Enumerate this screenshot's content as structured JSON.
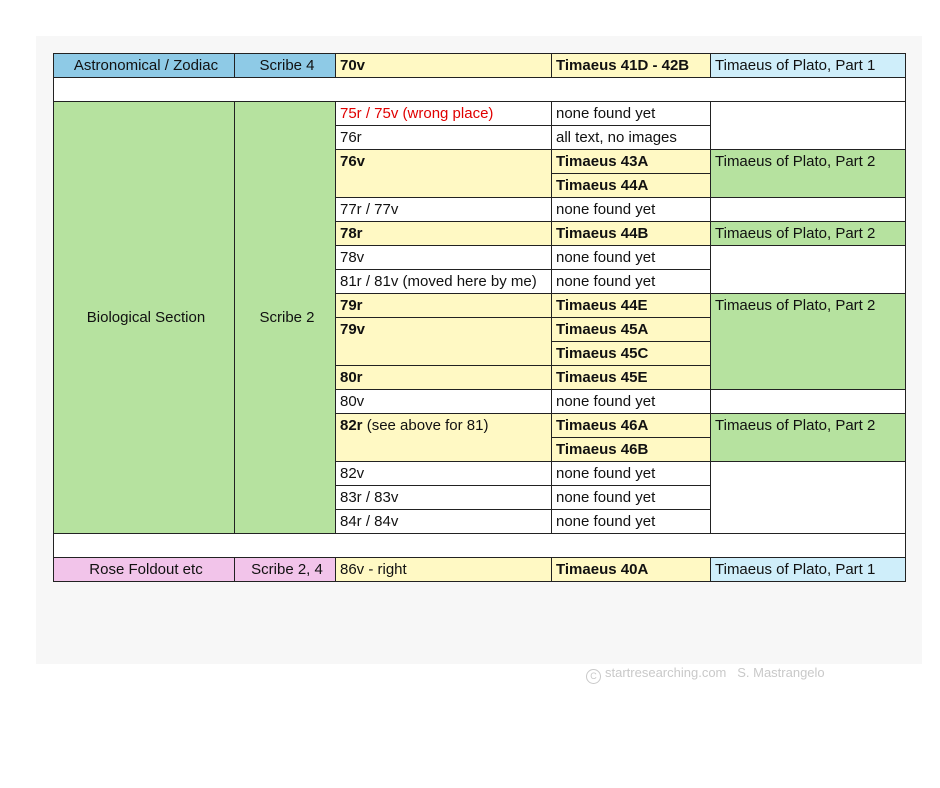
{
  "rows": {
    "astro": {
      "section": "Astronomical / Zodiac",
      "scribe": "Scribe 4",
      "folio": "70v",
      "timaeus": "Timaeus 41D - 42B",
      "part": "Timaeus of Plato, Part 1"
    },
    "bio": {
      "section": "Biological Section",
      "scribe": "Scribe 2"
    },
    "r1": {
      "folio": "75r / 75v  (wrong place)",
      "timaeus": "none found yet"
    },
    "r2": {
      "folio": "76r",
      "timaeus": "all text, no images"
    },
    "r3": {
      "folio": "76v",
      "timaeus": "Timaeus 43A",
      "part": "Timaeus of Plato, Part 2"
    },
    "r4": {
      "timaeus": "Timaeus 44A"
    },
    "r5": {
      "folio": "77r / 77v",
      "timaeus": "none found yet"
    },
    "r6": {
      "folio": "78r",
      "timaeus": "Timaeus 44B",
      "part": "Timaeus of Plato, Part 2"
    },
    "r7": {
      "folio": "78v",
      "timaeus": "none found yet"
    },
    "r8": {
      "folio": "81r / 81v (moved here by me)",
      "timaeus": "none found yet"
    },
    "r9": {
      "folio": "79r",
      "timaeus": "Timaeus 44E",
      "part": "Timaeus of Plato, Part 2"
    },
    "r10": {
      "folio": "79v",
      "timaeus": "Timaeus 45A"
    },
    "r11": {
      "timaeus": "Timaeus 45C"
    },
    "r12": {
      "folio": "80r",
      "timaeus": "Timaeus 45E"
    },
    "r13": {
      "folio": "80v",
      "timaeus": "none found yet"
    },
    "r14": {
      "folio": "82r",
      "folio_note": " (see above for 81)",
      "timaeus": "Timaeus 46A",
      "part": "Timaeus of Plato, Part 2"
    },
    "r15": {
      "timaeus": "Timaeus 46B"
    },
    "r16": {
      "folio": "82v",
      "timaeus": "none found yet"
    },
    "r17": {
      "folio": "83r / 83v",
      "timaeus": "none found yet"
    },
    "r18": {
      "folio": "84r / 84v",
      "timaeus": "none found yet"
    },
    "rose": {
      "section": "Rose Foldout etc",
      "scribe": "Scribe 2, 4",
      "folio": "86v - right",
      "timaeus": "Timaeus 40A",
      "part": "Timaeus of Plato, Part 1"
    }
  },
  "footer": {
    "copyright_symbol": "C",
    "credit": "startresearching.com   S. Mastrangelo"
  },
  "colors": {
    "astro": "#8ecae6",
    "biological": "#b6e29f",
    "rose": "#f2c4ea",
    "highlight": "#fff9c4",
    "red_text": "#e00000"
  }
}
